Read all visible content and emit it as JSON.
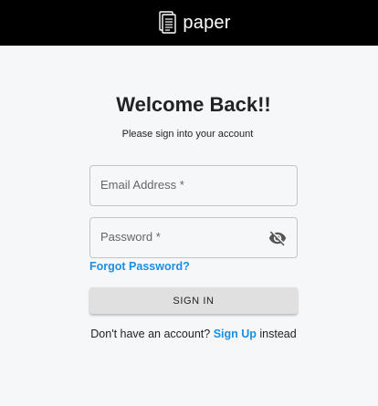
{
  "app": {
    "brand_name": "paper",
    "brand_icon": "paper-stack-icon"
  },
  "form": {
    "title": "Welcome Back!!",
    "subtitle": "Please sign into your account",
    "email_label": "Email Address *",
    "password_label": "Password *",
    "password_toggle_icon": "eye-off-icon",
    "forgot_password": "Forgot Password?",
    "submit_label": "SIGN IN",
    "signup_prefix": "Don't have an account?",
    "signup_link": "Sign Up",
    "signup_suffix": "instead"
  },
  "colors": {
    "topbar": "#000000",
    "background": "#f6f7f9",
    "link": "#1a8fe3",
    "button": "#e0e0e0"
  }
}
